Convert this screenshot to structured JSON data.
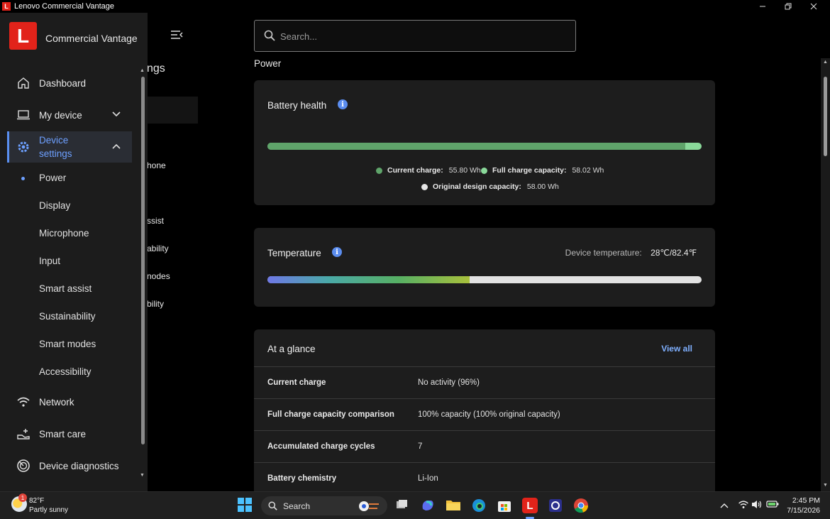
{
  "window": {
    "title": "Lenovo Commercial Vantage",
    "app_icon_letter": "L"
  },
  "brand": {
    "logo_letter": "L",
    "name": "Commercial Vantage"
  },
  "background_panel": {
    "heading_fragment": "ngs",
    "items": [
      "hone",
      "ssist",
      "ability",
      "nodes",
      "bility"
    ]
  },
  "nav": {
    "dashboard": "Dashboard",
    "my_device": "My device",
    "device_settings": "Device settings",
    "sub_items": [
      "Power",
      "Display",
      "Microphone",
      "Input",
      "Smart assist",
      "Sustainability",
      "Smart modes",
      "Accessibility"
    ],
    "network": "Network",
    "smart_care": "Smart care",
    "device_diagnostics": "Device diagnostics"
  },
  "search": {
    "placeholder": "Search..."
  },
  "section_title": "Power",
  "battery_health": {
    "title": "Battery health",
    "info_glyph": "i",
    "current_charge_label": "Current charge:",
    "current_charge_value": "55.80 Wh",
    "full_charge_label": "Full charge capacity:",
    "full_charge_value": "58.02 Wh",
    "design_label": "Original design capacity:",
    "design_value": "58.00 Wh",
    "current_fraction": 0.962,
    "colors": {
      "current": "#5fa46a",
      "full": "#8ad99a",
      "design": "#e6e6e6"
    }
  },
  "temperature": {
    "title": "Temperature",
    "info_glyph": "i",
    "label": "Device temperature:",
    "value": "28℃/82.4℉",
    "fill_fraction": 0.466
  },
  "at_a_glance": {
    "title": "At a glance",
    "view_all": "View all",
    "rows": [
      {
        "key": "Current charge",
        "value": "No activity (96%)"
      },
      {
        "key": "Full charge capacity comparison",
        "value": "100% capacity (100% original capacity)"
      },
      {
        "key": "Accumulated charge cycles",
        "value": "7"
      },
      {
        "key": "Battery chemistry",
        "value": "Li-Ion"
      }
    ]
  },
  "taskbar": {
    "weather_temp": "82°F",
    "weather_desc": "Partly sunny",
    "weather_badge": "1",
    "search_label": "Search",
    "time": "2:45 PM",
    "date": "7/15/2026"
  },
  "colors": {
    "accent": "#5a8ff0",
    "brand_red": "#e2231a",
    "link": "#7fb0ff"
  }
}
